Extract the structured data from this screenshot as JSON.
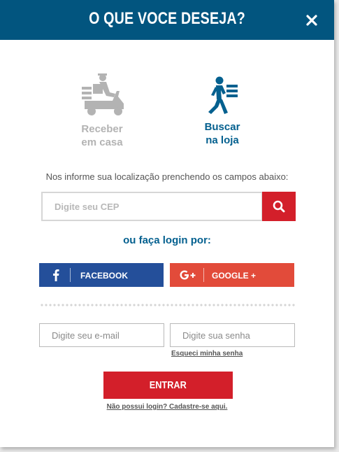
{
  "modal": {
    "title": "O QUE VOCE DESEJA?",
    "close_icon": "close-icon"
  },
  "options": {
    "delivery": {
      "label_line1": "Receber",
      "label_line2": "em casa",
      "icon": "delivery-scooter-icon",
      "state": "inactive"
    },
    "pickup": {
      "label_line1": "Buscar",
      "label_line2": "na loja",
      "icon": "walking-person-icon",
      "state": "active"
    }
  },
  "location": {
    "instruction": "Nos informe sua localização prenchendo os campos abaixo:",
    "cep_placeholder": "Digite seu CEP",
    "search_icon": "search-icon"
  },
  "login": {
    "or_label": "ou faça login por:",
    "facebook_label": "FACEBOOK",
    "google_label": "GOOGLE +",
    "email_placeholder": "Digite seu e-mail",
    "password_placeholder": "Digite sua senha",
    "forgot_label": "Esqueci minha senha",
    "enter_label": "ENTRAR",
    "register_label": "Não possui login? Cadastre-se aqui."
  },
  "colors": {
    "header": "#02557f",
    "accent_blue": "#04608f",
    "red": "#d31f2a",
    "facebook": "#244f9a",
    "google": "#e24b3a",
    "inactive": "#b3b3b3"
  }
}
